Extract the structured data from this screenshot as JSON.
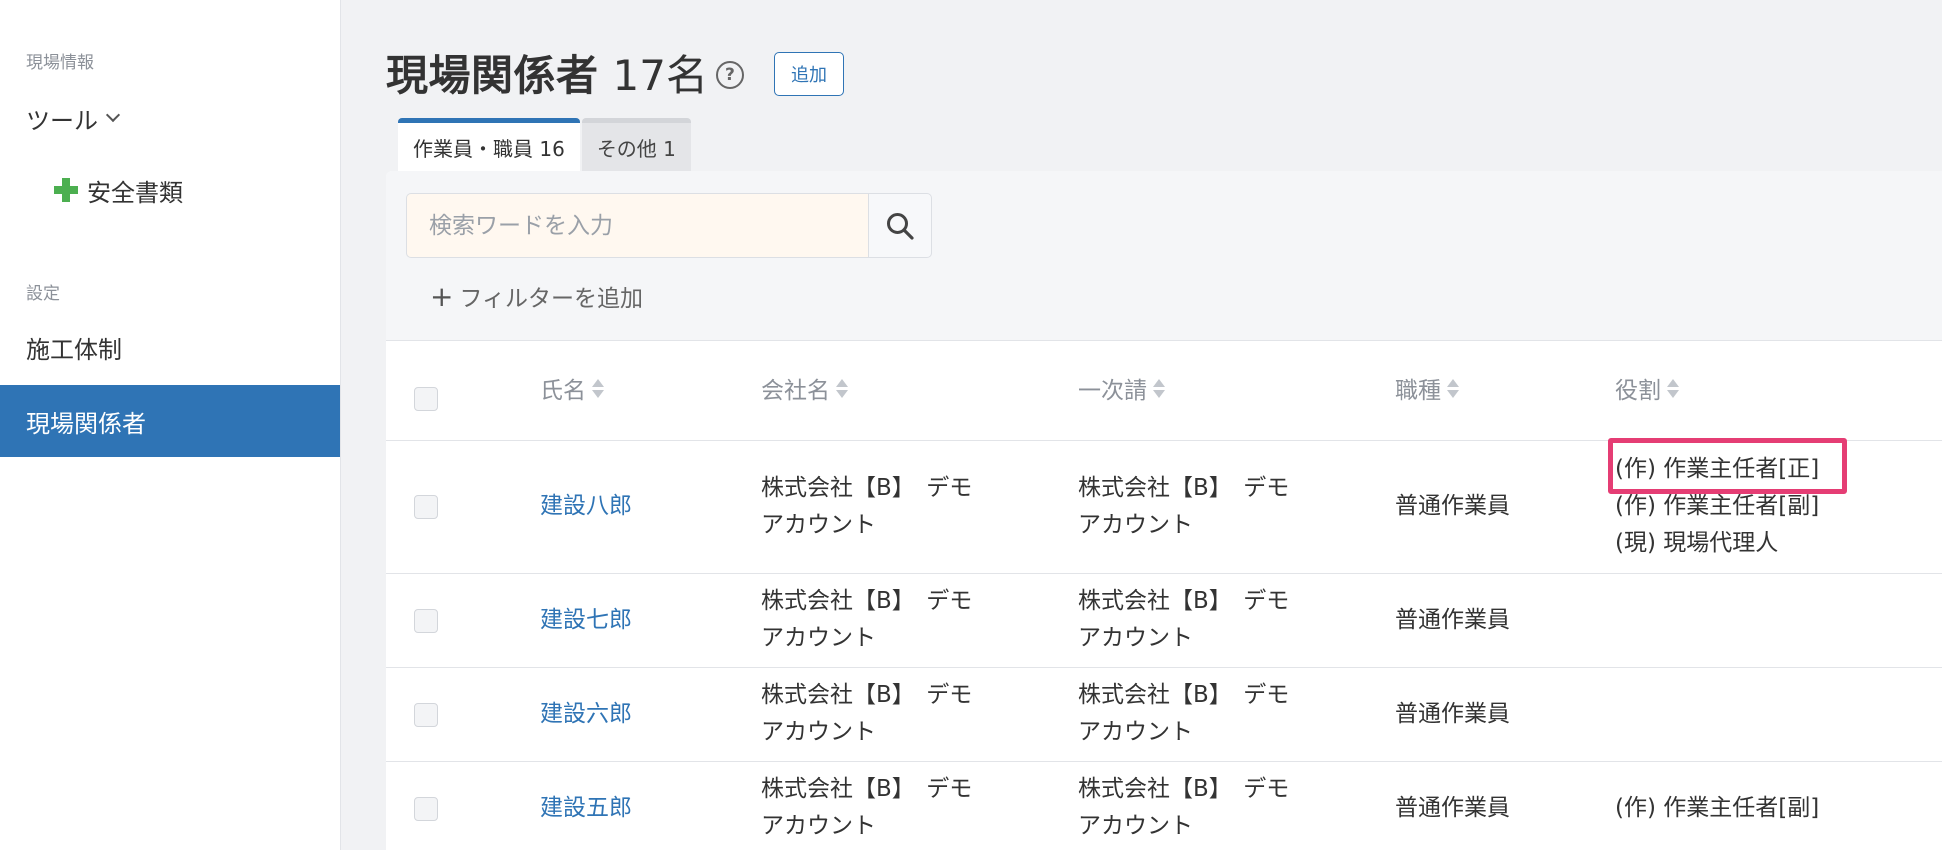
{
  "sidebar": {
    "section_site_info": "現場情報",
    "tools_label": "ツール",
    "safety_docs_label": "安全書類",
    "section_settings": "設定",
    "construction_system_label": "施工体制",
    "site_members_label": "現場関係者"
  },
  "header": {
    "title": "現場関係者",
    "count": "17名",
    "help": "?",
    "add_label": "追加"
  },
  "tabs": [
    {
      "label": "作業員・職員 16"
    },
    {
      "label": "その他 1"
    }
  ],
  "search": {
    "placeholder": "検索ワードを入力",
    "add_filter_label": "フィルターを追加",
    "add_filter_plus": "+"
  },
  "table": {
    "columns": [
      "氏名",
      "会社名",
      "一次請",
      "職種",
      "役割"
    ],
    "rows": [
      {
        "name": "建設八郎",
        "company": [
          "株式会社【B】　デモ",
          "アカウント"
        ],
        "primary": [
          "株式会社【B】　デモ",
          "アカウント"
        ],
        "job": "普通作業員",
        "roles": [
          "(作) 作業主任者[正]",
          "(作) 作業主任者[副]",
          "(現) 現場代理人"
        ]
      },
      {
        "name": "建設七郎",
        "company": [
          "株式会社【B】　デモ",
          "アカウント"
        ],
        "primary": [
          "株式会社【B】　デモ",
          "アカウント"
        ],
        "job": "普通作業員",
        "roles": []
      },
      {
        "name": "建設六郎",
        "company": [
          "株式会社【B】　デモ",
          "アカウント"
        ],
        "primary": [
          "株式会社【B】　デモ",
          "アカウント"
        ],
        "job": "普通作業員",
        "roles": []
      },
      {
        "name": "建設五郎",
        "company": [
          "株式会社【B】　デモ",
          "アカウント"
        ],
        "primary": [
          "株式会社【B】　デモ",
          "アカウント"
        ],
        "job": "普通作業員",
        "roles": [
          "(作) 作業主任者[副]"
        ]
      }
    ]
  },
  "colors": {
    "accent": "#2f74b5",
    "highlight": "#e53d74",
    "search_bg": "#fff8f0"
  }
}
